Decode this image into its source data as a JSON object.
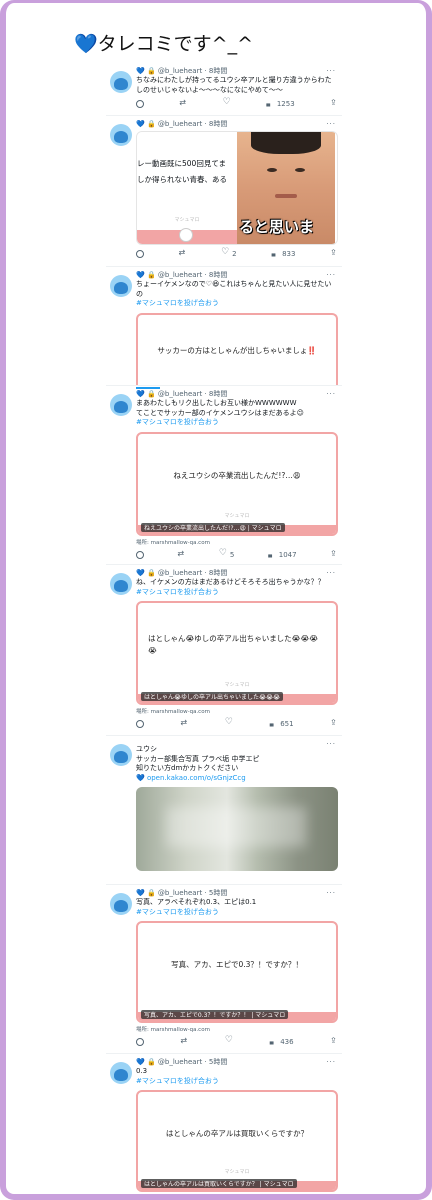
{
  "page_title": "💙タレコミです^_^",
  "tweets": [
    {
      "handle": "@b_lueheart",
      "time": "8時間",
      "text": "ちなみにわたしが持ってるユウシ卒アルと撮り方違うからわたしのせいじゃないよ〜〜〜なになにやめて〜〜",
      "views": "1253"
    },
    {
      "handle": "@b_lueheart",
      "time": "8時間",
      "media_text_1": "レー動画既に500回見てま",
      "media_text_2": "しか得られない青春、ある",
      "media_caption": "ると思いま",
      "brand": "マシュマロ",
      "likes": "2",
      "views": "833"
    },
    {
      "handle": "@b_lueheart",
      "time": "8時間",
      "text": "ちょーイケメンなので♡😆これはちゃんと見たい人に見せたいの",
      "link": "#マシュマロを投げ合おう",
      "card_text": "サッカーの方はとしゃんが出しちゃいましょ‼️"
    },
    {
      "handle": "@b_lueheart",
      "time": "8時間",
      "text": "まあわたしもリク出したしお互い様かWWWWWW\nてことでサッカー部のイケメンユウシはまだあるよ😉",
      "link": "#マシュマロを投げ合おう",
      "card_text": "ねえユウシの卒業流出したんだ!?…😩",
      "brand": "マシュマロ",
      "caption": "ねえユウシの卒業流出したんだ!?…😩 | マシュマロ",
      "site": "場所: marshmallow-qa.com",
      "likes": "5",
      "views": "1047"
    },
    {
      "handle": "@b_lueheart",
      "time": "8時間",
      "text": "ね、イケメンの方はまだあるけどそろそろ出ちゃうかな？？",
      "link": "#マシュマロを投げ合おう",
      "card_text": "はとしゃん😭ゆしの卒アル出ちゃいました😭😭😭😭",
      "brand": "マシュマロ",
      "caption": "はとしゃん😭ゆしの卒アル出ちゃいました😭😭😭",
      "site": "場所: marshmallow-qa.com",
      "views": "651"
    },
    {
      "text": "ユウシ\nサッカー部集合写真 プラベ垢 中学エピ\n知りたい方dmかカトクください",
      "link": "💙 open.kakao.com/o/sGnjzCcg"
    },
    {
      "handle": "@b_lueheart",
      "time": "5時間",
      "text": "写真、アラベそれぞれ0.3、エピは0.1",
      "link": "#マシュマロを投げ合おう",
      "card_text": "写真、アカ、エピで0.3？！ですか？！",
      "caption": "写真、アカ、エピで0.3？！ですか？！ | マシュマロ",
      "site": "場所: marshmallow-qa.com",
      "views": "436"
    },
    {
      "handle": "@b_lueheart",
      "time": "5時間",
      "text": "0.3",
      "link": "#マシュマロを投げ合おう",
      "card_text": "はとしゃんの卒アルは買取いくらですか？",
      "brand": "マシュマロ",
      "caption": "はとしゃんの卒アルは買取いくらですか？ | マシュマロ"
    }
  ]
}
